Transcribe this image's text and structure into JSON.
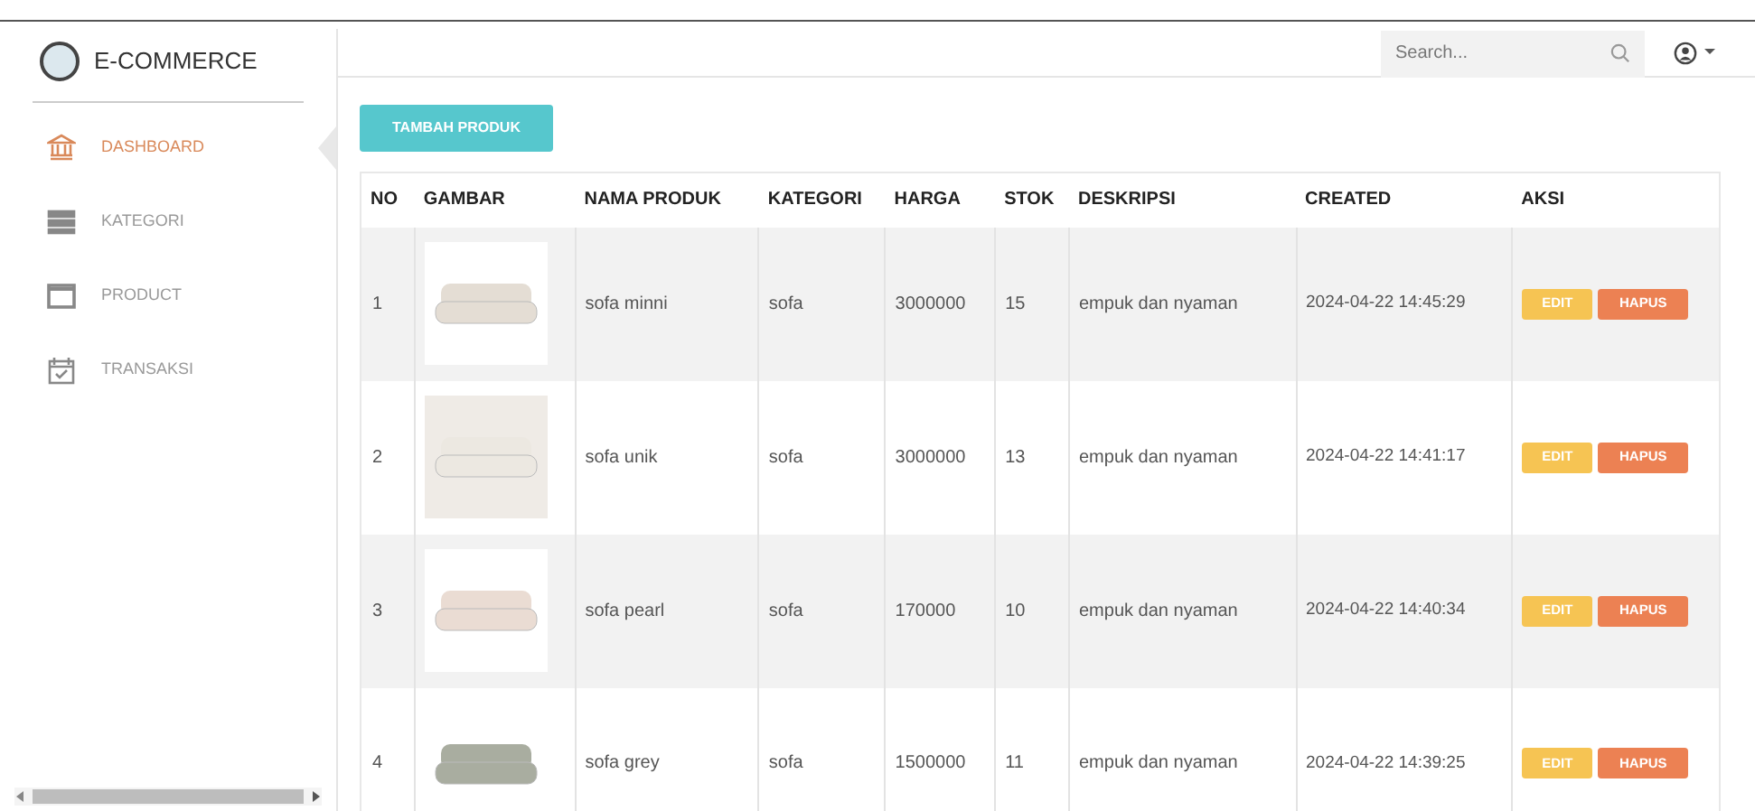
{
  "brand": {
    "title": "E-COMMERCE"
  },
  "sidebar": {
    "items": [
      {
        "label": "DASHBOARD",
        "selected": true
      },
      {
        "label": "KATEGORI",
        "selected": false
      },
      {
        "label": "PRODUCT",
        "selected": false
      },
      {
        "label": "TRANSAKSI",
        "selected": false
      }
    ]
  },
  "header": {
    "search": {
      "placeholder": "Search..."
    }
  },
  "add_button": "TAMBAH PRODUK",
  "table": {
    "columns": [
      "NO",
      "GAMBAR",
      "NAMA PRODUK",
      "KATEGORI",
      "HARGA",
      "STOK",
      "DESKRIPSI",
      "CREATED",
      "AKSI"
    ],
    "rows": [
      {
        "no": "1",
        "name": "sofa minni",
        "category": "sofa",
        "price": "3000000",
        "stock": "15",
        "description": "empuk dan nyaman",
        "created": "2024-04-22 14:45:29",
        "edit": "EDIT",
        "delete": "HAPUS"
      },
      {
        "no": "2",
        "name": "sofa unik",
        "category": "sofa",
        "price": "3000000",
        "stock": "13",
        "description": "empuk dan nyaman",
        "created": "2024-04-22 14:41:17",
        "edit": "EDIT",
        "delete": "HAPUS"
      },
      {
        "no": "3",
        "name": "sofa pearl",
        "category": "sofa",
        "price": "170000",
        "stock": "10",
        "description": "empuk dan nyaman",
        "created": "2024-04-22 14:40:34",
        "edit": "EDIT",
        "delete": "HAPUS"
      },
      {
        "no": "4",
        "name": "sofa grey",
        "category": "sofa",
        "price": "1500000",
        "stock": "11",
        "description": "empuk dan nyaman",
        "created": "2024-04-22 14:39:25",
        "edit": "EDIT",
        "delete": "HAPUS"
      }
    ]
  }
}
